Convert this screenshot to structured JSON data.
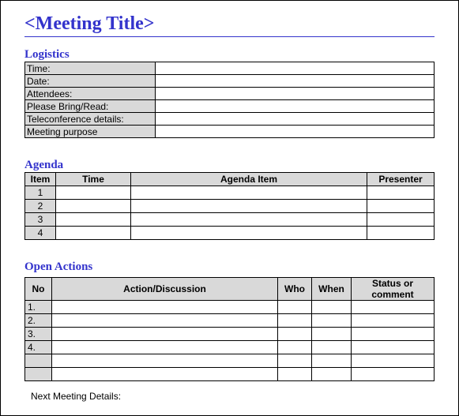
{
  "title": "<Meeting Title>",
  "logistics": {
    "heading": "Logistics",
    "rows": [
      {
        "label": "Time:",
        "value": ""
      },
      {
        "label": "Date:",
        "value": ""
      },
      {
        "label": "Attendees:",
        "value": ""
      },
      {
        "label": "Please Bring/Read:",
        "value": ""
      },
      {
        "label": "Teleconference details:",
        "value": ""
      },
      {
        "label": "Meeting purpose",
        "value": ""
      }
    ]
  },
  "agenda": {
    "heading": "Agenda",
    "headers": {
      "item": "Item",
      "time": "Time",
      "agenda_item": "Agenda Item",
      "presenter": "Presenter"
    },
    "rows": [
      {
        "no": "1",
        "time": "",
        "item": "",
        "presenter": ""
      },
      {
        "no": "2",
        "time": "",
        "item": "",
        "presenter": ""
      },
      {
        "no": "3",
        "time": "",
        "item": "",
        "presenter": ""
      },
      {
        "no": "4",
        "time": "",
        "item": "",
        "presenter": ""
      }
    ]
  },
  "open_actions": {
    "heading": "Open Actions",
    "headers": {
      "no": "No",
      "action": "Action/Discussion",
      "who": "Who",
      "when": "When",
      "status": "Status or comment"
    },
    "rows": [
      {
        "no": "1.",
        "action": "",
        "who": "",
        "when": "",
        "status": ""
      },
      {
        "no": "2.",
        "action": "",
        "who": "",
        "when": "",
        "status": ""
      },
      {
        "no": "3.",
        "action": "",
        "who": "",
        "when": "",
        "status": ""
      },
      {
        "no": "4.",
        "action": "",
        "who": "",
        "when": "",
        "status": ""
      },
      {
        "no": "",
        "action": "",
        "who": "",
        "when": "",
        "status": ""
      },
      {
        "no": "",
        "action": "",
        "who": "",
        "when": "",
        "status": ""
      }
    ]
  },
  "next_meeting": "Next Meeting Details:"
}
